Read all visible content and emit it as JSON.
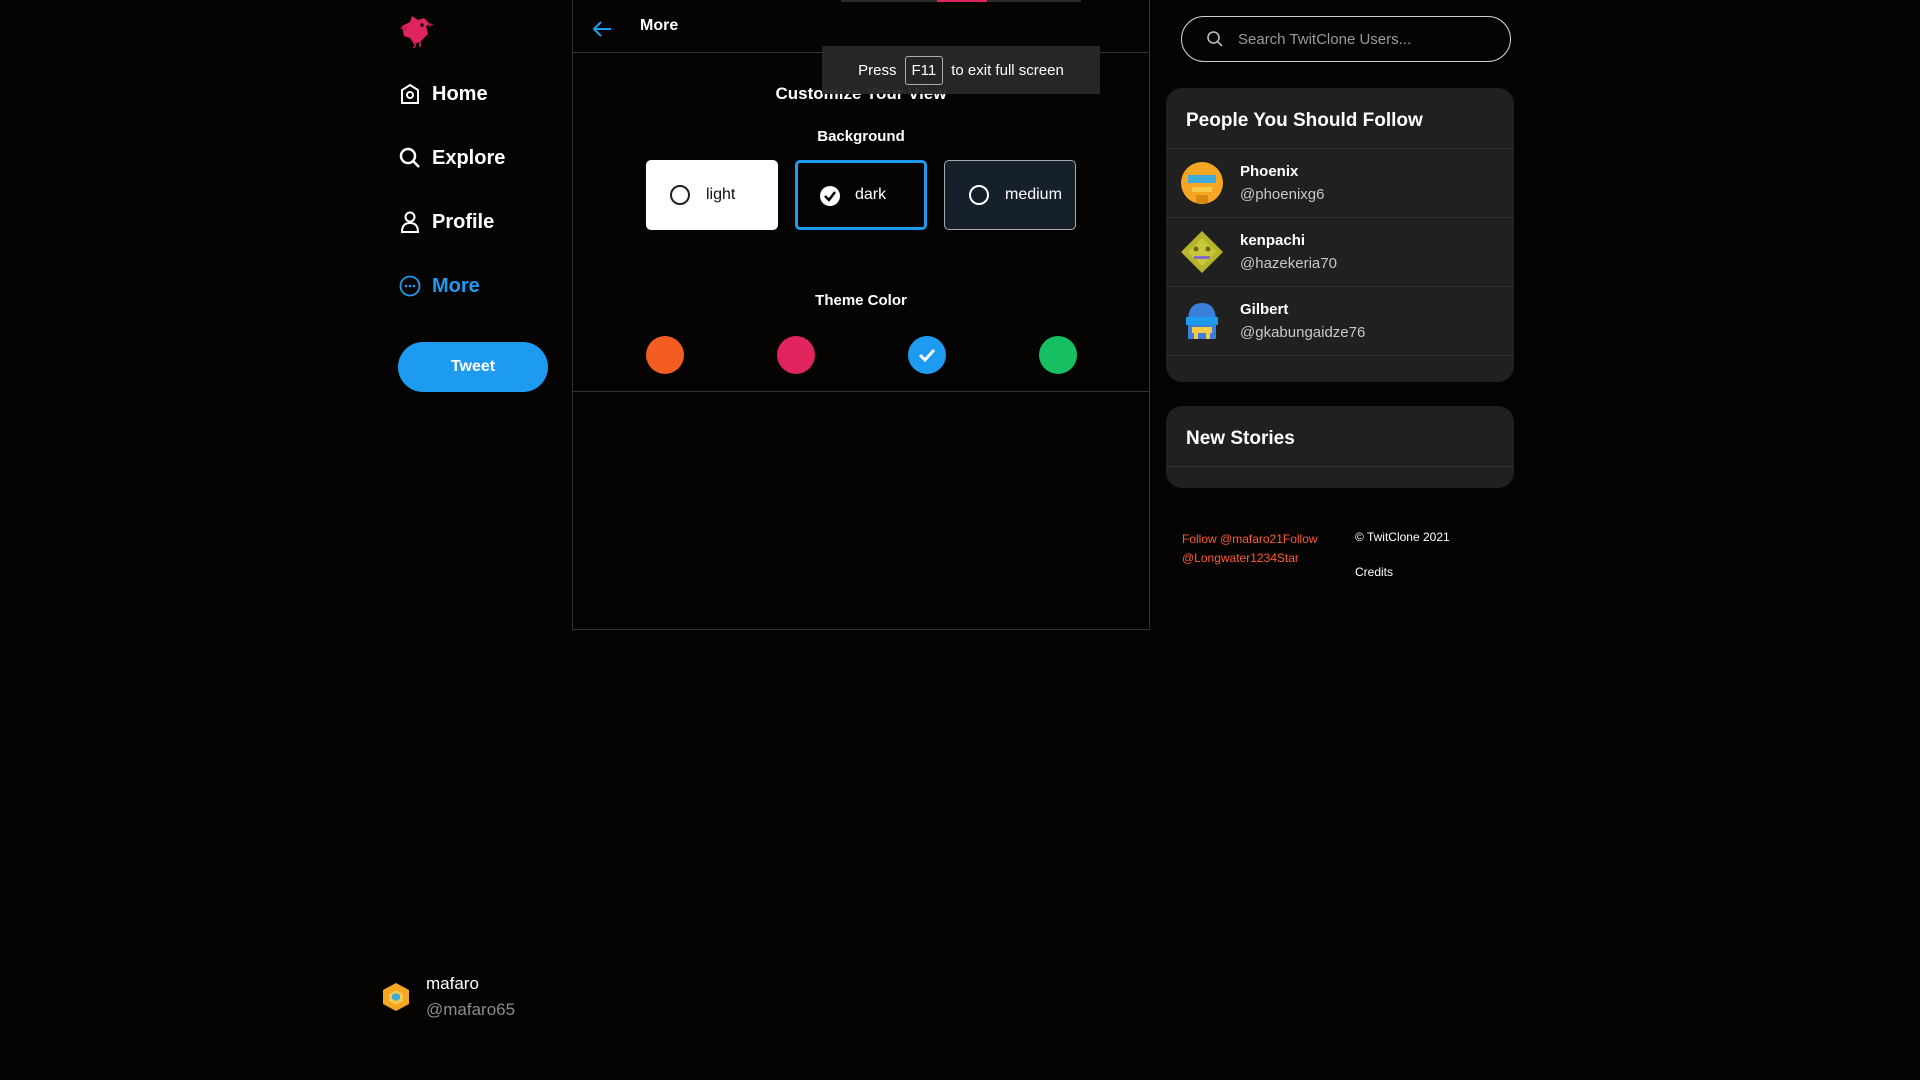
{
  "sidebar": {
    "nav": [
      {
        "label": "Home",
        "icon": "home-icon"
      },
      {
        "label": "Explore",
        "icon": "search-icon"
      },
      {
        "label": "Profile",
        "icon": "user-icon"
      },
      {
        "label": "More",
        "icon": "more-icon",
        "active": true
      }
    ],
    "tweet_label": "Tweet",
    "account": {
      "name": "mafaro",
      "handle": "@mafaro65"
    }
  },
  "header": {
    "title": "More"
  },
  "fullscreen_hint": {
    "prefix": "Press",
    "key": "F11",
    "suffix": "to exit full screen"
  },
  "customize": {
    "title": "Customize Your View",
    "background_label": "Background",
    "background_options": [
      {
        "label": "light",
        "selected": false
      },
      {
        "label": "dark",
        "selected": true
      },
      {
        "label": "medium",
        "selected": false
      }
    ],
    "theme_label": "Theme Color",
    "theme_colors": [
      {
        "name": "orange",
        "hex": "#f45d22",
        "selected": false
      },
      {
        "name": "pink",
        "hex": "#e0245e",
        "selected": false
      },
      {
        "name": "blue",
        "hex": "#1d9bf0",
        "selected": true
      },
      {
        "name": "green",
        "hex": "#17bf63",
        "selected": false
      }
    ]
  },
  "search": {
    "placeholder": "Search TwitClone Users..."
  },
  "follow": {
    "title": "People You Should Follow",
    "people": [
      {
        "name": "Phoenix",
        "handle": "@phoenixg6"
      },
      {
        "name": "kenpachi",
        "handle": "@hazekeria70"
      },
      {
        "name": "Gilbert",
        "handle": "@gkabungaidze76"
      }
    ]
  },
  "stories": {
    "title": "New Stories"
  },
  "footer": {
    "link1": "Follow @mafaro21",
    "link2": "Follow @Longwater1234Star",
    "copyright": "© TwitClone 2021",
    "credits": "Credits"
  },
  "colors": {
    "accent": "#1d9bf0",
    "brand": "#e0245e",
    "link": "#ff5a36"
  }
}
